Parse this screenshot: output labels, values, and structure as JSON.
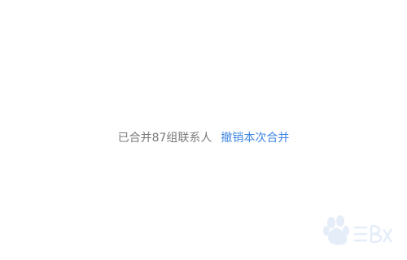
{
  "merge_notice": {
    "status_text": "已合并87组联系人",
    "undo_link_label": "撤销本次合并"
  },
  "watermark": {
    "text": "Baidu经验"
  },
  "colors": {
    "status_text": "#7a7a7a",
    "link": "#3e86e0",
    "background": "#ffffff"
  }
}
